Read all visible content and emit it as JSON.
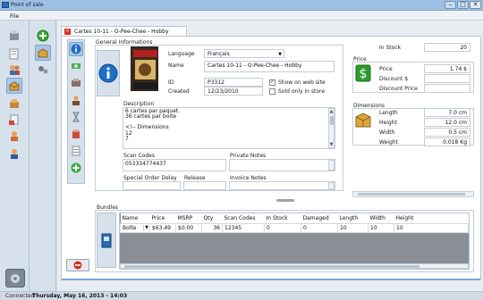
{
  "window": {
    "title": "Point of sale",
    "minimize": "–",
    "maximize": "□",
    "close": "✕"
  },
  "menu": {
    "file": "File"
  },
  "tab": {
    "title": "Cartes 10-11 - O-Pee-Chee - Hobby"
  },
  "general": {
    "section_label": "General Informations",
    "language_label": "Language",
    "language_value": "Français",
    "name_label": "Name",
    "name_value": "Cartes 10-11 - O-Pee-Chee - Hobby",
    "id_label": "ID",
    "id_value": "P3312",
    "created_label": "Created",
    "created_value": "12/23/2010",
    "show_web_label": "Show on web site",
    "show_web_checked": true,
    "sold_store_label": "Sold only in store",
    "sold_store_checked": false,
    "description_label": "Description",
    "description_lines": [
      "6 cartes par paquet.",
      "36 cartes par boite",
      "",
      "<!-- Dimensions",
      "12",
      "7"
    ],
    "scan_codes_label": "Scan Codes",
    "scan_codes_value": "053334774437",
    "private_notes_label": "Private Notes",
    "special_order_label": "Special Order Delay",
    "release_label": "Release",
    "invoice_notes_label": "Invoice Notes"
  },
  "stock": {
    "label": "In Stock",
    "value": "20"
  },
  "price": {
    "section_label": "Price",
    "price_label": "Price",
    "price_value": "1.74 $",
    "discount_label": "Discount $",
    "discount_price_label": "Discount Price"
  },
  "dimensions": {
    "section_label": "Dimensions",
    "length_label": "Length",
    "length_value": "7.0 cm",
    "height_label": "Height",
    "height_value": "12.0 cm",
    "width_label": "Width",
    "width_value": "0.5 cm",
    "weight_label": "Weight",
    "weight_value": "0.018 Kg"
  },
  "bundles": {
    "section_label": "Bundles",
    "columns": [
      "Name",
      "Price",
      "MSRP",
      "Qty",
      "Scan Codes",
      "In Stock",
      "Damaged",
      "Length",
      "Width",
      "Height"
    ],
    "rows": [
      [
        "Boîte",
        "$63.49",
        "$0.00",
        "36",
        "12345",
        "0",
        "0",
        "10",
        "10",
        "10"
      ]
    ]
  },
  "status": {
    "connection": "Connected",
    "datetime": "Thursday, May 16, 2013 - 14:03"
  },
  "colors": {
    "accent": "#1e6fc7",
    "money": "#2e9a2e",
    "delete": "#d6301f"
  }
}
